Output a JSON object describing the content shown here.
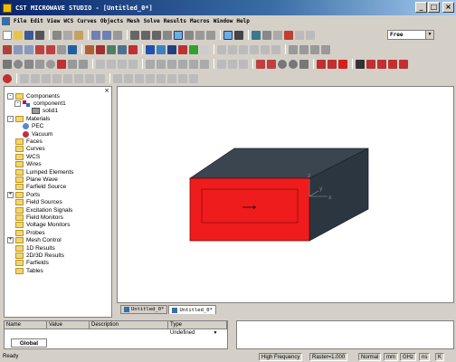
{
  "window": {
    "title": "CST MICROWAVE STUDIO - [Untitled_0*]",
    "buttons": [
      "_",
      "□",
      "×"
    ]
  },
  "menu": [
    "File",
    "Edit",
    "View",
    "WCS",
    "Curves",
    "Objects",
    "Mesh",
    "Solve",
    "Results",
    "Macros",
    "Window",
    "Help"
  ],
  "toolbar": {
    "mode_select": "Free"
  },
  "tree": {
    "close": "×",
    "nodes": [
      {
        "label": "Components",
        "type": "folder",
        "expander": "-"
      },
      {
        "label": "component1",
        "type": "component",
        "expander": "-"
      },
      {
        "label": "solid1",
        "type": "solid"
      },
      {
        "label": "Materials",
        "type": "folder",
        "expander": "-"
      },
      {
        "label": "PEC",
        "type": "material",
        "color": "#5a88c8"
      },
      {
        "label": "Vacuum",
        "type": "material",
        "color": "#c03040"
      },
      {
        "label": "Faces",
        "type": "folder"
      },
      {
        "label": "Curves",
        "type": "folder"
      },
      {
        "label": "WCS",
        "type": "folder"
      },
      {
        "label": "Wires",
        "type": "folder"
      },
      {
        "label": "Lumped Elements",
        "type": "folder"
      },
      {
        "label": "Plane Wave",
        "type": "folder"
      },
      {
        "label": "Farfield Source",
        "type": "folder"
      },
      {
        "label": "Ports",
        "type": "folder",
        "expander": "+"
      },
      {
        "label": "Field Sources",
        "type": "folder"
      },
      {
        "label": "Excitation Signals",
        "type": "folder"
      },
      {
        "label": "Field Monitors",
        "type": "folder"
      },
      {
        "label": "Voltage Monitors",
        "type": "folder"
      },
      {
        "label": "Probes",
        "type": "folder"
      },
      {
        "label": "Mesh Control",
        "type": "folder",
        "expander": "+"
      },
      {
        "label": "1D Results",
        "type": "folder"
      },
      {
        "label": "2D/3D Results",
        "type": "folder"
      },
      {
        "label": "Farfields",
        "type": "folder"
      },
      {
        "label": "Tables",
        "type": "folder"
      }
    ]
  },
  "viewport": {
    "axis_labels": {
      "z": "z",
      "x": "x",
      "y": "y"
    },
    "colors": {
      "box_front": "#ee1c1c",
      "box_top": "#3a4550",
      "box_side": "#2c3640"
    }
  },
  "doc_tabs": [
    "Untitled_0*",
    "Untitled_0*"
  ],
  "params": {
    "headers": [
      "Name",
      "Value",
      "Description",
      "Type"
    ],
    "rows": [
      {
        "name": "",
        "value": "",
        "description": "",
        "type": "Undefined"
      }
    ],
    "tab": "Global"
  },
  "status": {
    "left": "Ready",
    "items": [
      "High Frequency",
      "Raster=1.000",
      "Normal",
      "mm",
      "GHz",
      "ns",
      "K"
    ]
  }
}
